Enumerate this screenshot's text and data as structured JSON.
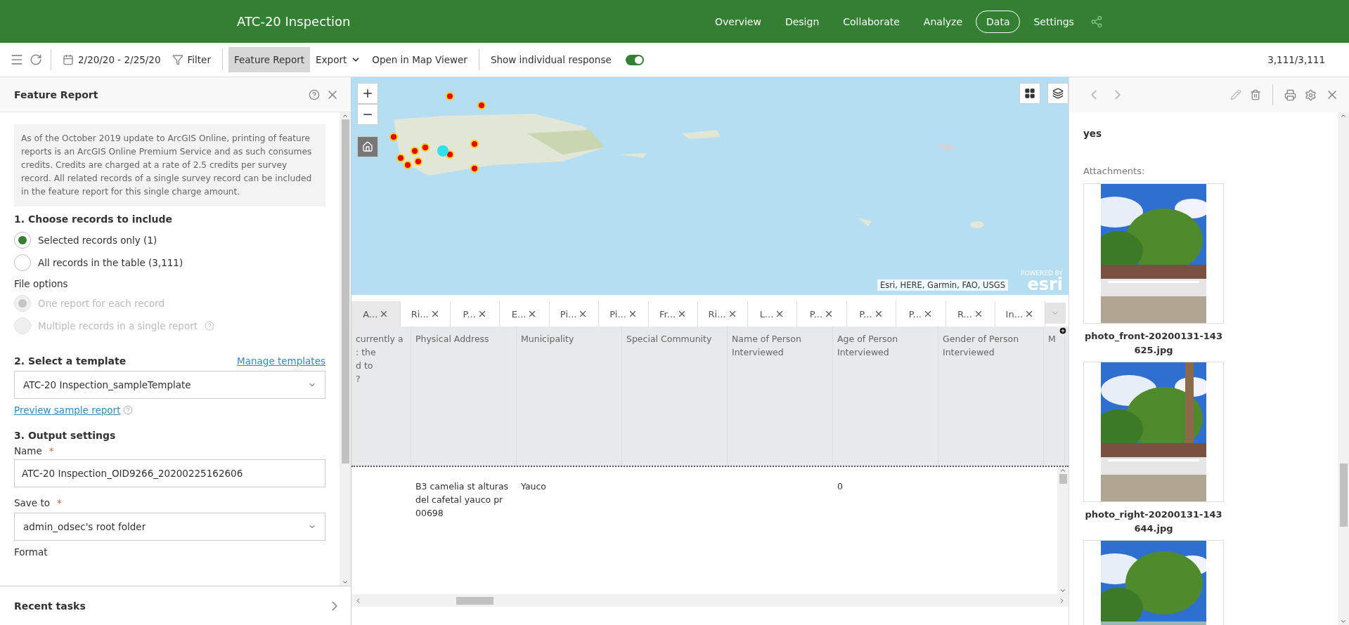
{
  "header": {
    "title": "ATC-20 Inspection",
    "nav": [
      {
        "label": "Overview",
        "selected": false
      },
      {
        "label": "Design",
        "selected": false
      },
      {
        "label": "Collaborate",
        "selected": false
      },
      {
        "label": "Analyze",
        "selected": false
      },
      {
        "label": "Data",
        "selected": true
      },
      {
        "label": "Settings",
        "selected": false
      }
    ]
  },
  "toolbar": {
    "date_range": "2/20/20 - 2/25/20",
    "filter": "Filter",
    "actions": [
      {
        "label": "Feature Report",
        "selected": true
      },
      {
        "label": "Export",
        "selected": false,
        "dropdown": true
      },
      {
        "label": "Open in Map Viewer",
        "selected": false
      }
    ],
    "toggle": {
      "label": "Show individual response",
      "on": true
    },
    "count": "3,111/3,111"
  },
  "feature_report": {
    "title": "Feature Report",
    "notice": "As of the October 2019 update to ArcGIS Online, printing of feature reports is an ArcGIS Online Premium Service and as such consumes credits. Credits are charged at a rate of 2.5 credits per survey record. All related records of a single survey record can be included in the feature report for this single charge amount.",
    "records_heading": "1. Choose records to include",
    "records": [
      {
        "label": "Selected records only (1)",
        "selected": true,
        "disabled": false
      },
      {
        "label": "All records in the table (3,111)",
        "selected": false,
        "disabled": false
      }
    ],
    "file_options_label": "File options",
    "file_options": [
      {
        "label": "One report for each record",
        "selected": true,
        "disabled": true,
        "help": false
      },
      {
        "label": "Multiple records in a single report",
        "selected": false,
        "disabled": true,
        "help": true
      }
    ],
    "template_heading": "2. Select a template",
    "manage_link": "Manage templates",
    "template": "ATC-20 Inspection_sampleTemplate",
    "preview_link": "Preview sample report",
    "output_heading": "3. Output settings",
    "name_label": "Name",
    "name_value": "ATC-20 Inspection_OID9266_20200225162606",
    "save_label": "Save to",
    "save_value": "admin_odsec's root folder",
    "format_label": "Format",
    "required_mark": "*",
    "recent_tasks": "Recent tasks"
  },
  "map": {
    "attribution": "Esri, HERE, Garmin, FAO, USGS",
    "logo_caption": "POWERED BY",
    "logo": "esri"
  },
  "table": {
    "tabs": [
      {
        "label": "A...",
        "selected": true
      },
      {
        "label": "Ri...",
        "selected": false
      },
      {
        "label": "P...",
        "selected": false
      },
      {
        "label": "E...",
        "selected": false
      },
      {
        "label": "Pi...",
        "selected": false
      },
      {
        "label": "Pi...",
        "selected": false
      },
      {
        "label": "Fr...",
        "selected": false
      },
      {
        "label": "Ri...",
        "selected": false
      },
      {
        "label": "L...",
        "selected": false
      },
      {
        "label": "P...",
        "selected": false
      },
      {
        "label": "P...",
        "selected": false
      },
      {
        "label": "P...",
        "selected": false
      },
      {
        "label": "R...",
        "selected": false
      },
      {
        "label": "In...",
        "selected": false
      }
    ],
    "columns": [
      "currently a\n: the\nd to\n?",
      "Physical Address",
      "Municipality",
      "Special Community",
      "Name of Person Interviewed",
      "Age of Person Interviewed",
      "Gender of Person Interviewed",
      "M"
    ],
    "rows": [
      [
        "",
        "B3 camelia st alturas del cafetal yauco pr 00698",
        "Yauco",
        "",
        "",
        "0",
        "",
        ""
      ]
    ]
  },
  "details": {
    "value": "yes",
    "attachments_label": "Attachments:",
    "attachments": [
      {
        "name": "photo_front-20200131-143625.jpg",
        "kind": "picture"
      },
      {
        "name": "photo_right-20200131-143644.jpg",
        "kind": "picture"
      },
      {
        "kind": "picture"
      }
    ]
  }
}
